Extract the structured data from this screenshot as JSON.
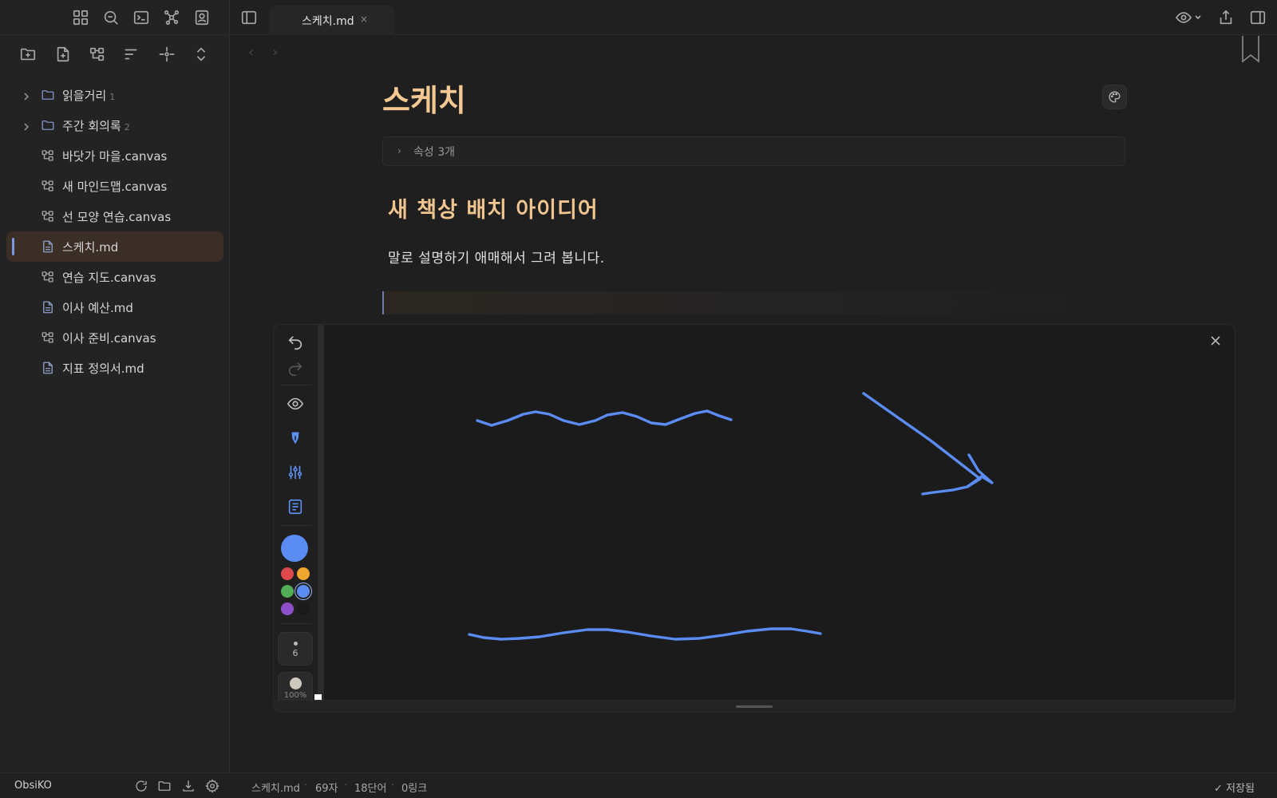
{
  "sidebar": {
    "ribbon_icons": [
      "dashboard-icon",
      "search-icon",
      "terminal-icon",
      "graph-icon",
      "profile-icon"
    ],
    "nav_action_icons": [
      "new-folder-icon",
      "new-note-icon",
      "new-canvas-icon",
      "sort-icon",
      "reveal-file-icon",
      "collapse-all-icon"
    ],
    "tree": [
      {
        "type": "folder",
        "label": "읽을거리",
        "count": "1"
      },
      {
        "type": "folder",
        "label": "주간 회의록",
        "count": "2"
      },
      {
        "type": "canvas",
        "label": "바닷가 마을.canvas"
      },
      {
        "type": "canvas",
        "label": "새 마인드맵.canvas"
      },
      {
        "type": "canvas",
        "label": "선 모양 연습.canvas"
      },
      {
        "type": "md",
        "label": "스케치.md",
        "active": true
      },
      {
        "type": "canvas",
        "label": "연습 지도.canvas"
      },
      {
        "type": "md",
        "label": "이사 예산.md"
      },
      {
        "type": "canvas",
        "label": "이사 준비.canvas"
      },
      {
        "type": "md",
        "label": "지표 정의서.md"
      }
    ]
  },
  "tabbar": {
    "tab_title": "스케치.md",
    "tab_close": "×",
    "right_icons": [
      "eye-icon",
      "share-icon",
      "right-sidebar-icon"
    ]
  },
  "editor": {
    "back": "‹",
    "forward": "›",
    "title": "스케치",
    "properties_label": "속성 3개",
    "heading": "새 책상 배치 아이디어",
    "paragraph": "말로 설명하기 애매해서 그려 봅니다."
  },
  "drawing": {
    "tools": [
      "undo-icon",
      "redo-icon",
      "eye-icon",
      "pen-icon",
      "sliders-icon",
      "document-icon"
    ],
    "current_color": "#5b8cf3",
    "swatches": [
      "#e0494b",
      "#f0a62c",
      "#52ad57",
      "#5b8cf3",
      "#8f4fc9",
      "#1a1a1a"
    ],
    "selected_swatch": 3,
    "stroke_width": "6",
    "opacity_label": "100%",
    "stroke_color": "#5b8cf3"
  },
  "statusbar": {
    "vault": "ObsiKO",
    "file": "스케치.md",
    "chars": "69자",
    "words": "18단어",
    "links": "0링크",
    "sep": "·",
    "saved": "✓ 저장됨"
  }
}
